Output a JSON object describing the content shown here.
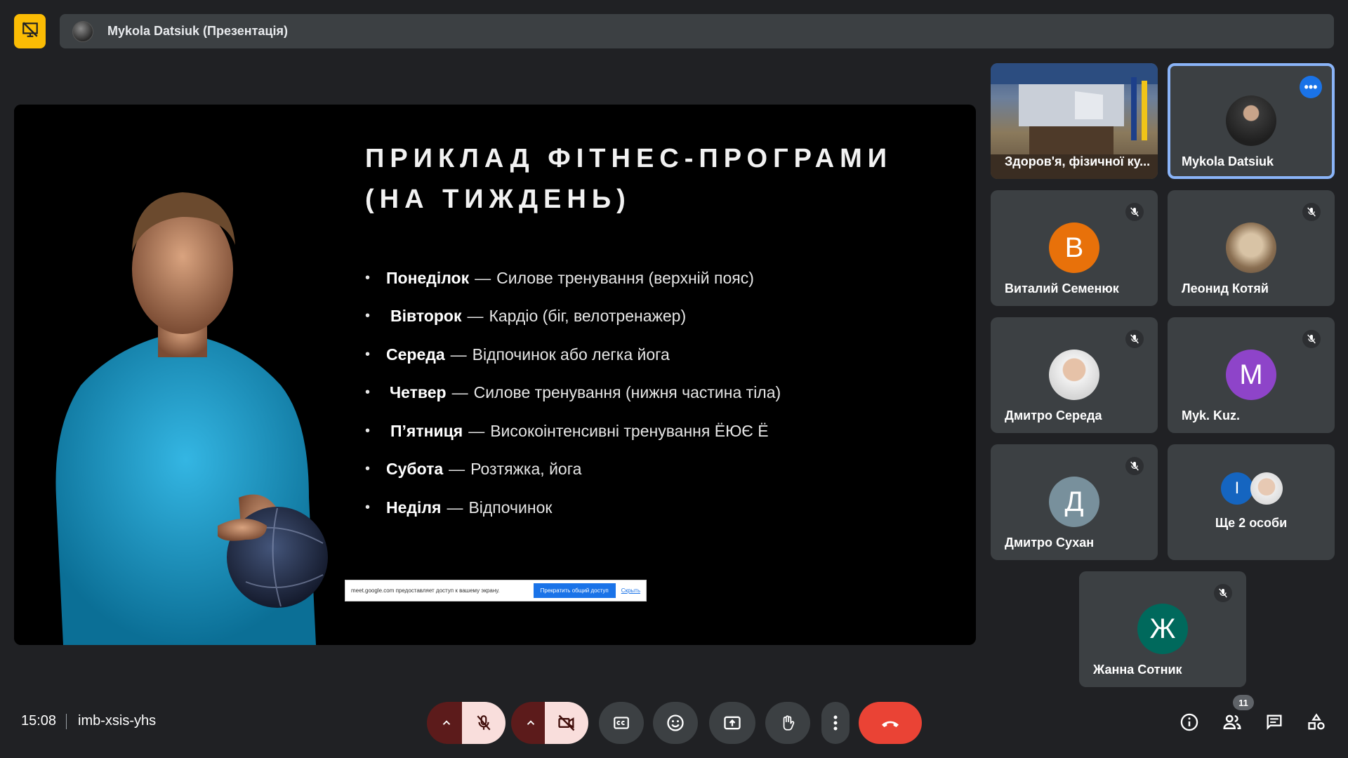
{
  "top": {
    "presenter_label": "Mykola Datsiuk (Презентація)"
  },
  "slide": {
    "title_line1": "ПРИКЛАД ФІТНЕС-ПРОГРАМИ",
    "title_line2": "(НА ТИЖДЕНЬ)",
    "items": [
      {
        "day": "Понеділок",
        "sep": "—",
        "text": "Силове тренування (верхній пояс)"
      },
      {
        "day": "Вівторок",
        "sep": "—",
        "text": "Кардіо (біг, велотренажер)"
      },
      {
        "day": "Середа",
        "sep": "—",
        "text": "Відпочинок або легка йога"
      },
      {
        "day": "Четвер",
        "sep": "—",
        "text": "Силове тренування (нижня частина тіла)"
      },
      {
        "day": "П’ятниця",
        "sep": "—",
        "text": "Високоінтенсивні тренування ЁЮЄ Ё"
      },
      {
        "day": "Субота",
        "sep": "—",
        "text": "Розтяжка, йога"
      },
      {
        "day": "Неділя",
        "sep": "—",
        "text": "Відпочинок"
      }
    ],
    "share_banner": {
      "text": "meet.google.com предоставляет доступ к вашему экрану.",
      "stop_label": "Прекратить общий доступ",
      "hide_label": "Скрыть"
    }
  },
  "participants": [
    {
      "name": "Здоров'я, фізичної ку...",
      "type": "video"
    },
    {
      "name": "Mykola Datsiuk",
      "type": "photo",
      "active": true
    },
    {
      "name": "Виталий Семенюк",
      "initial": "В",
      "color": "#e8710a",
      "muted": true
    },
    {
      "name": "Леонид Котяй",
      "type": "photo",
      "muted": true
    },
    {
      "name": "Дмитро Середа",
      "type": "photo",
      "muted": true
    },
    {
      "name": "Myk. Kuz.",
      "initial": "M",
      "color": "#8e44c9",
      "muted": true
    },
    {
      "name": "Дмитро Сухан",
      "initial": "Д",
      "color": "#78909c",
      "muted": true
    },
    {
      "name": "Ще 2 особи",
      "type": "group",
      "initial": "I",
      "color": "#1565c0"
    },
    {
      "name": "Жанна Сотник",
      "initial": "Ж",
      "color": "#00695c",
      "muted": true
    }
  ],
  "bottom": {
    "time": "15:08",
    "meeting_code": "imb-xsis-yhs",
    "people_count": "11"
  },
  "colors": {
    "present_accent": "#fbbc04",
    "end_call": "#ea4335",
    "mic_off_bg": "#f9dedc",
    "active_border": "#8ab4f8"
  }
}
